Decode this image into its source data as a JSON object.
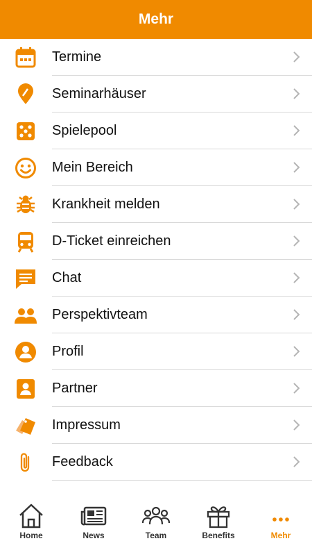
{
  "header": {
    "title": "Mehr"
  },
  "menu": {
    "items": [
      {
        "label": "Termine",
        "icon": "calendar-icon"
      },
      {
        "label": "Seminarhäuser",
        "icon": "map-pin-icon"
      },
      {
        "label": "Spielepool",
        "icon": "dice-icon"
      },
      {
        "label": "Mein Bereich",
        "icon": "smiley-icon"
      },
      {
        "label": "Krankheit melden",
        "icon": "bug-icon"
      },
      {
        "label": "D-Ticket einreichen",
        "icon": "train-icon"
      },
      {
        "label": "Chat",
        "icon": "chat-icon"
      },
      {
        "label": "Perspektivteam",
        "icon": "people-icon"
      },
      {
        "label": "Profil",
        "icon": "user-circle-icon"
      },
      {
        "label": "Partner",
        "icon": "contact-card-icon"
      },
      {
        "label": "Impressum",
        "icon": "tags-icon"
      },
      {
        "label": "Feedback",
        "icon": "paperclip-icon"
      }
    ]
  },
  "tabbar": {
    "tabs": [
      {
        "label": "Home",
        "icon": "home-icon"
      },
      {
        "label": "News",
        "icon": "newspaper-icon"
      },
      {
        "label": "Team",
        "icon": "team-icon"
      },
      {
        "label": "Benefits",
        "icon": "gift-icon"
      },
      {
        "label": "Mehr",
        "icon": "more-dots-icon",
        "active": true
      }
    ]
  },
  "colors": {
    "accent": "#F08A00",
    "text": "#111111",
    "chevron": "#b5b5b5"
  }
}
